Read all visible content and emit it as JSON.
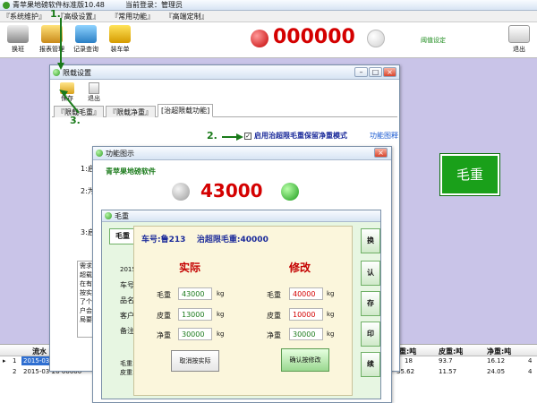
{
  "app": {
    "title": "青苹果地磅软件标准版10.48",
    "login_label": "当前登录：管理员"
  },
  "menu": [
    "『系统维护』",
    "『高级设置』",
    "『常用功能』",
    "『高端定制』"
  ],
  "toolbar": {
    "items": [
      "换班",
      "报表管理",
      "记录查询",
      "装车单"
    ],
    "exit": "退出"
  },
  "weight": {
    "value": "000000",
    "threshold_link": "阈值设定"
  },
  "side_button": "毛重",
  "limit_dialog": {
    "title": "限载设置",
    "buttons": {
      "save": "保存",
      "exit": "退出"
    },
    "tabs": [
      "『限载毛重』",
      "『限载净重』",
      "[治超限载功能]"
    ],
    "checkbox_label": "启用治超限毛重保留净重模式",
    "help_link": "功能图释",
    "left_fragments": [
      "1:启",
      "2:为",
      "3:启"
    ],
    "note_header": "需求",
    "note_lines": [
      "超载",
      "在有",
      "按实",
      "了个",
      "户会",
      "局要"
    ],
    "annotations": [
      "1.",
      "2.",
      "3."
    ]
  },
  "func_dialog": {
    "title": "功能图示",
    "header": "青苹果地磅软件",
    "weight": "43000"
  },
  "gross_dialog": {
    "title": "毛重",
    "header": "车号:鲁213    治超限毛重:40000",
    "actual_heading": "实际",
    "modify_heading": "修改",
    "field_labels": [
      "毛重",
      "皮重",
      "净重"
    ],
    "unit": "kg",
    "actual": {
      "gross": "43000",
      "tare": "13000",
      "net": "30000"
    },
    "modified": {
      "gross": "40000",
      "tare": "10000",
      "net": "30000"
    },
    "cancel_btn": "取消按实际",
    "confirm_btn": "确认按修改",
    "behind_left": [
      "毛重",
      "2015",
      "车号",
      "品名",
      "客户",
      "备注"
    ],
    "behind_right": [
      "换",
      "认",
      "存",
      "印",
      "续"
    ],
    "behind_bottom": [
      "毛重:",
      "皮重:"
    ]
  },
  "grid": {
    "headers": [
      "流水",
      "毛重:吨",
      "皮重:吨",
      "净重:吨"
    ],
    "rows": [
      {
        "marker": "▸",
        "num": "1",
        "date": "2015-03-",
        "gross": "18",
        "tare": "93.7",
        "net": "16.12",
        "last": "4"
      },
      {
        "marker": "",
        "num": "2",
        "date": "2015-03-20 00000",
        "gross": "35.62",
        "tare": "11.57",
        "net": "24.05",
        "last": "4"
      }
    ]
  }
}
